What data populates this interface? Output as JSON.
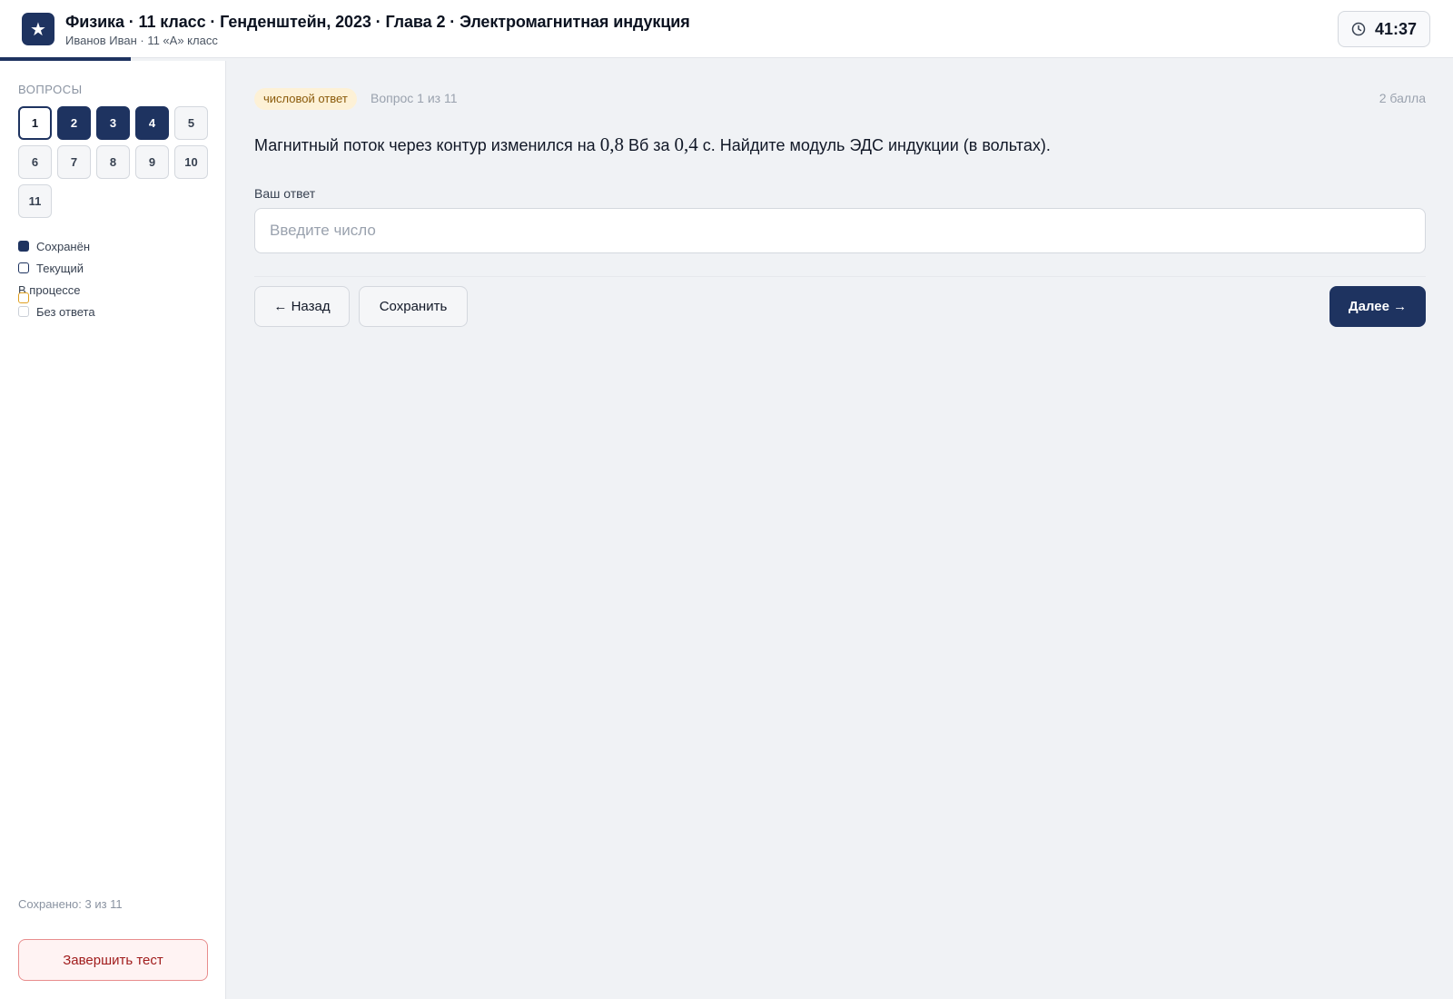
{
  "header": {
    "logo_glyph": "★",
    "title": "Физика · 11 класс · Генденштейн, 2023 · Глава 2 · Электромагнитная индукция",
    "subtitle": "Иванов Иван · 11 «А» класс",
    "timer": "41:37",
    "progress_fraction": 0.09
  },
  "sidebar": {
    "heading": "ВОПРОСЫ",
    "questions": [
      {
        "label": "1",
        "state": "current"
      },
      {
        "label": "2",
        "state": "saved"
      },
      {
        "label": "3",
        "state": "saved"
      },
      {
        "label": "4",
        "state": "saved"
      },
      {
        "label": "5",
        "state": "none"
      },
      {
        "label": "6",
        "state": "none"
      },
      {
        "label": "7",
        "state": "none"
      },
      {
        "label": "8",
        "state": "none"
      },
      {
        "label": "9",
        "state": "none"
      },
      {
        "label": "10",
        "state": "none"
      },
      {
        "label": "11",
        "state": "none"
      }
    ],
    "legend": [
      {
        "label": "Сохранён",
        "type": "saved"
      },
      {
        "label": "Текущий",
        "type": "current"
      },
      {
        "label": "В процессе",
        "type": "progress"
      },
      {
        "label": "Без ответа",
        "type": "noanswer"
      }
    ],
    "saved_count": "Сохранено: 3 из 11",
    "finish_label": "Завершить тест"
  },
  "main": {
    "badge": "числовой ответ",
    "question_number": "Вопрос 1 из 11",
    "points": "2 балла",
    "question": {
      "part1": "Магнитный поток через контур изменился на ",
      "value1": "0,8",
      "part2": " Вб за ",
      "value2": "0,4",
      "part3": " с. Найдите модуль ЭДС индукции (в вольтах)."
    },
    "answer_label": "Ваш ответ",
    "answer_placeholder": "Введите число",
    "answer_value": "",
    "back_label": "← Назад",
    "save_label": "Сохранить",
    "next_label": "Далее →"
  },
  "colors": {
    "primary": "#1e3360",
    "badge_bg": "#fdf1d6",
    "danger": "#a11d1d"
  }
}
